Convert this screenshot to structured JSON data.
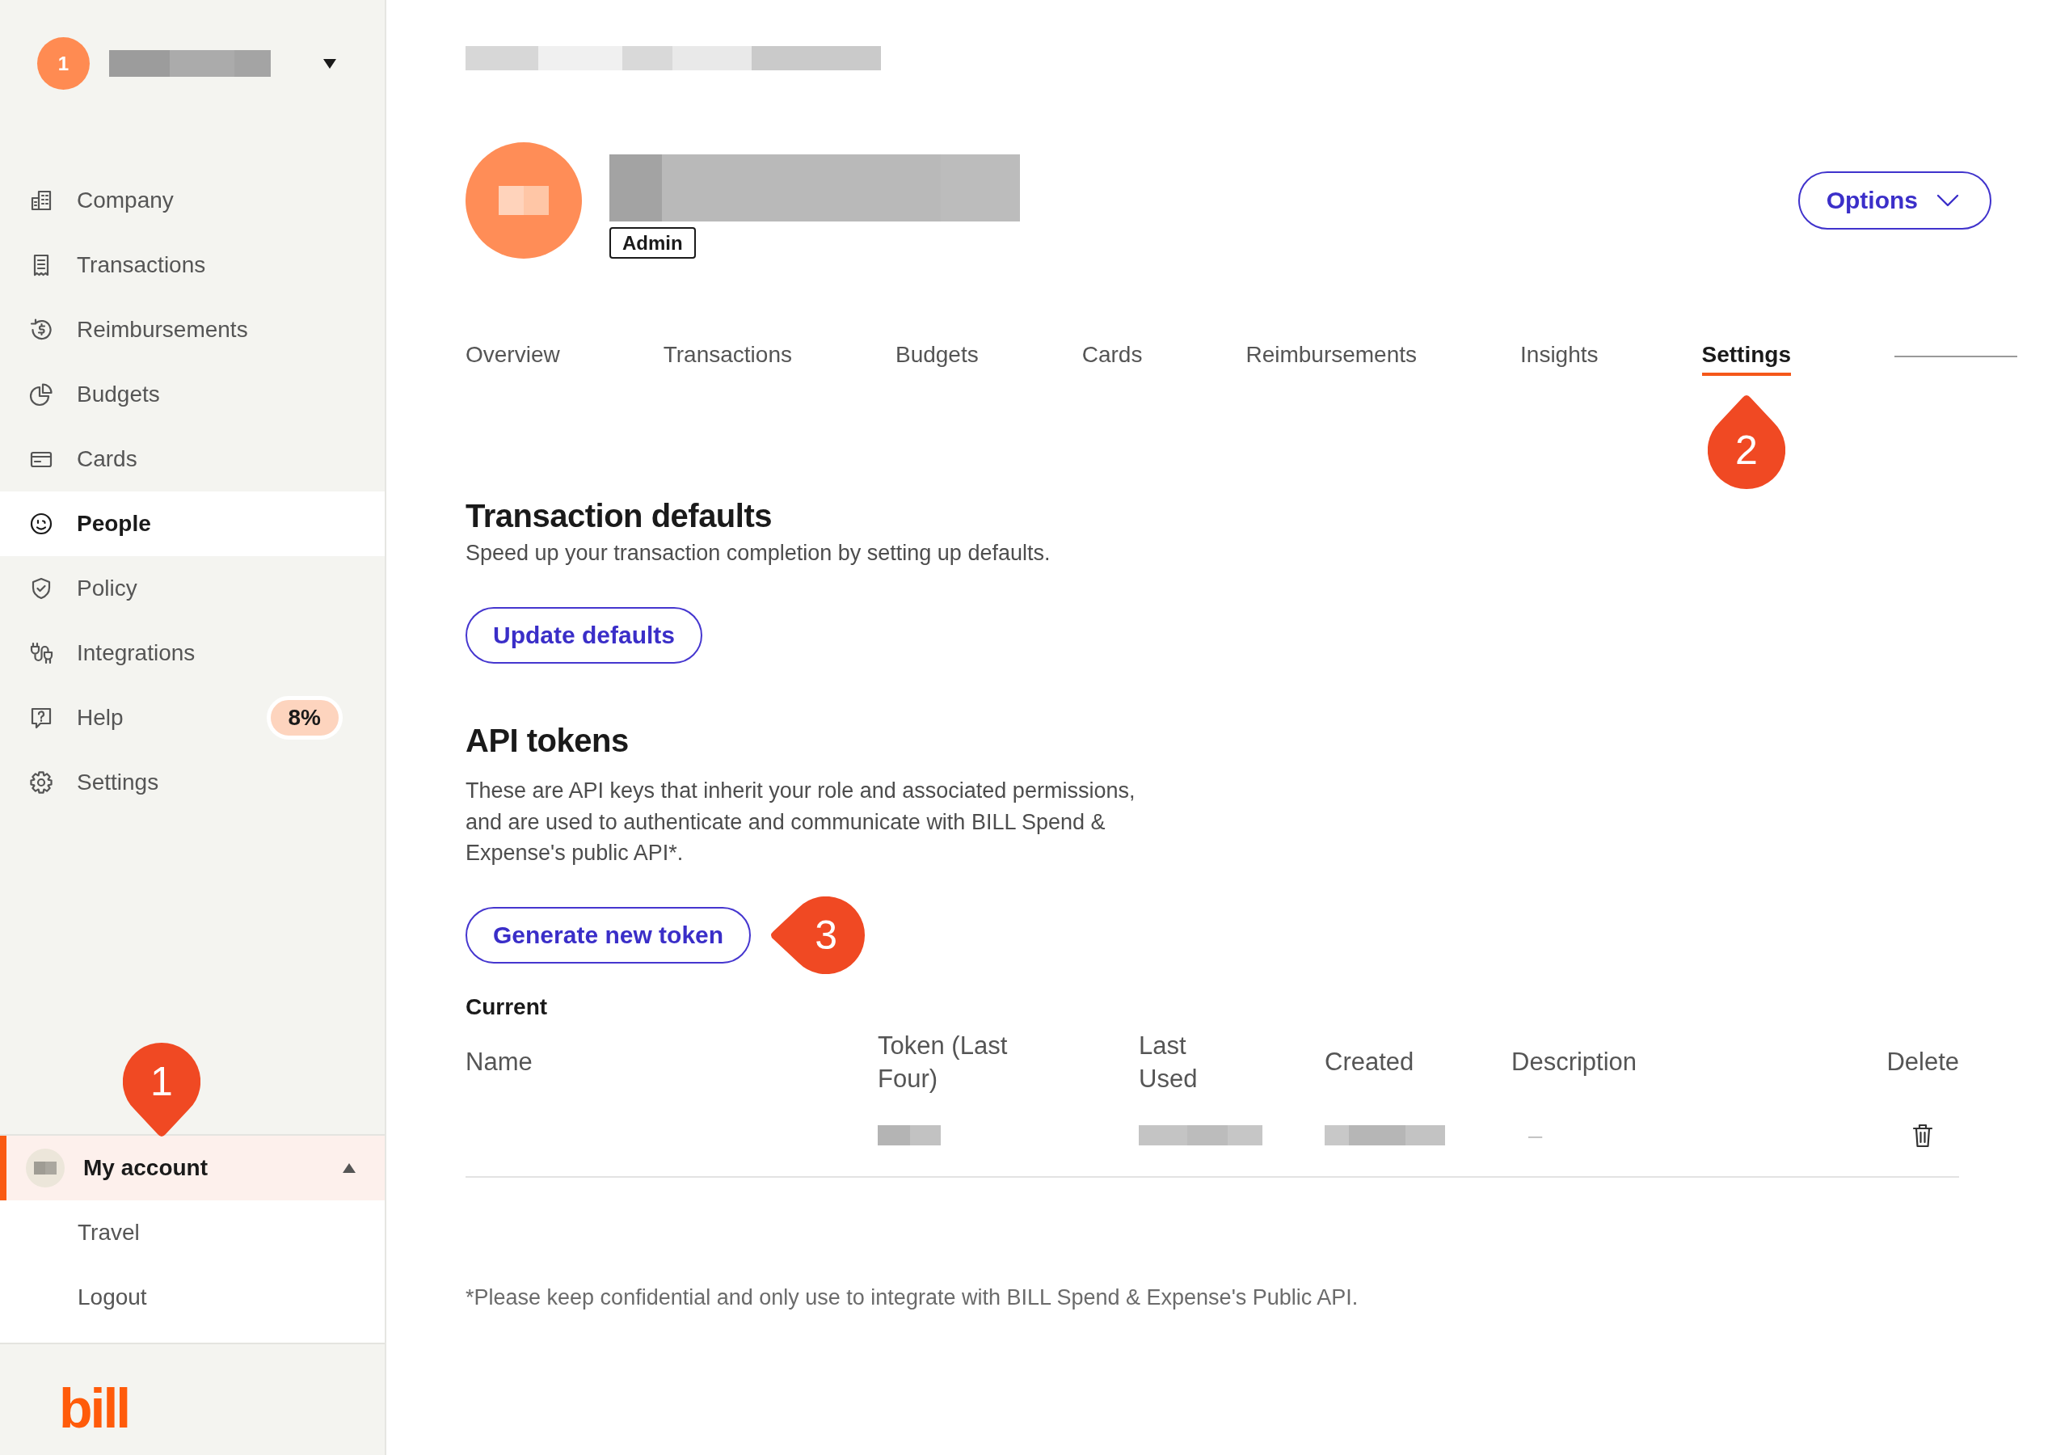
{
  "sidebar": {
    "switcher": {
      "badge": "1"
    },
    "nav": [
      {
        "label": "Company",
        "selected": false
      },
      {
        "label": "Transactions",
        "selected": false
      },
      {
        "label": "Reimbursements",
        "selected": false
      },
      {
        "label": "Budgets",
        "selected": false
      },
      {
        "label": "Cards",
        "selected": false
      },
      {
        "label": "People",
        "selected": true
      },
      {
        "label": "Policy",
        "selected": false
      },
      {
        "label": "Integrations",
        "selected": false
      },
      {
        "label": "Help",
        "selected": false,
        "badge": "8%"
      },
      {
        "label": "Settings",
        "selected": false
      }
    ],
    "account": {
      "label": "My account",
      "selected": true,
      "expanded": true,
      "callout": "1",
      "items": [
        {
          "label": "Travel"
        },
        {
          "label": "Logout"
        }
      ]
    },
    "logo": "bill"
  },
  "header": {
    "role": "Admin",
    "options_button": "Options"
  },
  "tabs": [
    {
      "label": "Overview",
      "selected": false
    },
    {
      "label": "Transactions",
      "selected": false
    },
    {
      "label": "Budgets",
      "selected": false
    },
    {
      "label": "Cards",
      "selected": false
    },
    {
      "label": "Reimbursements",
      "selected": false
    },
    {
      "label": "Insights",
      "selected": false
    },
    {
      "label": "Settings",
      "selected": true,
      "callout": "2"
    }
  ],
  "transaction_defaults": {
    "title": "Transaction defaults",
    "description": "Speed up your transaction completion by setting up defaults.",
    "button": "Update defaults"
  },
  "api_tokens": {
    "title": "API tokens",
    "description": "These are API keys that inherit your role and associated permissions, and are used to authenticate and communicate with BILL Spend & Expense's public API*.",
    "button": "Generate new token",
    "button_callout": "3",
    "table": {
      "title": "Current",
      "columns": [
        "Name",
        "Token (Last Four)",
        "Last Used",
        "Created",
        "Description",
        "Delete"
      ],
      "rows": [
        {
          "cells": [
            {
              "kind": "empty"
            },
            {
              "kind": "redacted"
            },
            {
              "kind": "redacted"
            },
            {
              "kind": "redacted"
            },
            {
              "kind": "text",
              "text": "–"
            },
            {
              "kind": "delete"
            }
          ]
        }
      ]
    },
    "footnote": "*Please keep confidential and only use to integrate with BILL Spend & Expense's Public API."
  }
}
